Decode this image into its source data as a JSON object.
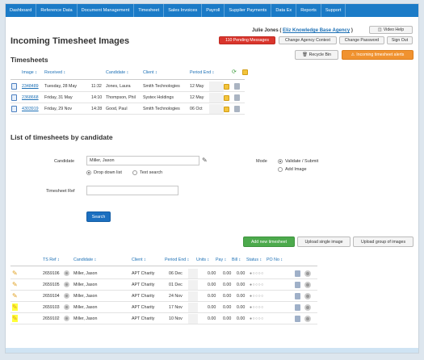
{
  "nav": {
    "items": [
      "Dashboard",
      "Reference Data",
      "Document Management",
      "Timesheet",
      "Sales Invoices",
      "Payroll",
      "Supplier Payments",
      "Data Ex",
      "Reports",
      "Support"
    ]
  },
  "header": {
    "user_name": "Julie Jones (",
    "agency_link": "Eliz Knowledge Base Agency",
    "agency_close": " )",
    "video_help": "Video Help",
    "pending_messages": "110 Pending Messages",
    "change_agency": "Change Agency Context",
    "change_password": "Change Password",
    "sign_out": "Sign Out",
    "recycle_bin": "Recycle Bin",
    "incoming_alerts": "Incoming timesheet alerts"
  },
  "page_title": "Incoming Timesheet Images",
  "timesheets": {
    "heading": "Timesheets",
    "columns": [
      "Image ↕",
      "Received ↕",
      "Candidate ↕",
      "Client ↕",
      "Period End ↕"
    ],
    "rows": [
      {
        "image": "2348489",
        "received_day": "Tuesday, 28 May",
        "time": "11:32",
        "candidate": "Jones, Laura",
        "client": "Smith Technologies",
        "period_end": "12 May"
      },
      {
        "image": "2368668",
        "received_day": "Friday, 31 May",
        "time": "14:10",
        "candidate": "Thompson, Phil",
        "client": "Systex Holdings",
        "period_end": "12 May"
      },
      {
        "image": "4303919",
        "received_day": "Friday, 29 Nov",
        "time": "14:28",
        "candidate": "Good, Paul",
        "client": "Smith Technologies",
        "period_end": "06 Oct"
      }
    ]
  },
  "candidate_section": {
    "heading": "List of timesheets by candidate",
    "candidate_label": "Candidate",
    "candidate_value": "Miller, Jason",
    "dropdown_option": "Drop down list",
    "text_search_option": "Text search",
    "mode_label": "Mode",
    "mode_validate": "Validate / Submit",
    "mode_add_image": "Add Image",
    "ts_ref_label": "Timesheet Ref",
    "search_button": "Search"
  },
  "actions": {
    "add_new": "Add new timesheet",
    "upload_single": "Upload single image",
    "upload_group": "Upload group of images"
  },
  "candidate_table": {
    "columns": [
      "TS Ref ↕",
      "Candidate ↕",
      "Client ↕",
      "Period End ↕",
      "Units ↕",
      "Pay ↕",
      "Bill ↕",
      "Status ↕",
      "PO No ↕"
    ],
    "rows": [
      {
        "ts_ref": "2659106",
        "candidate": "Miller, Jason",
        "client": "APT Charity",
        "period_end": "06 Dec",
        "units": "0.00",
        "pay": "0.00",
        "bill": "0.00",
        "highlighted": false
      },
      {
        "ts_ref": "2659105",
        "candidate": "Miller, Jason",
        "client": "APT Charity",
        "period_end": "01 Dec",
        "units": "0.00",
        "pay": "0.00",
        "bill": "0.00",
        "highlighted": false
      },
      {
        "ts_ref": "2659104",
        "candidate": "Miller, Jason",
        "client": "APT Charity",
        "period_end": "24 Nov",
        "units": "0.00",
        "pay": "0.00",
        "bill": "0.00",
        "highlighted": false
      },
      {
        "ts_ref": "2659103",
        "candidate": "Miller, Jason",
        "client": "APT Charity",
        "period_end": "17 Nov",
        "units": "0.00",
        "pay": "0.00",
        "bill": "0.00",
        "highlighted": true
      },
      {
        "ts_ref": "2659102",
        "candidate": "Miller, Jason",
        "client": "APT Charity",
        "period_end": "10 Nov",
        "units": "0.00",
        "pay": "0.00",
        "bill": "0.00",
        "highlighted": true
      }
    ]
  },
  "colors": {
    "nav": "#1b7bc7",
    "accent_red": "#d9352c",
    "accent_orange": "#f0922f",
    "accent_green": "#4caa4c",
    "highlight": "#ffff3a"
  }
}
